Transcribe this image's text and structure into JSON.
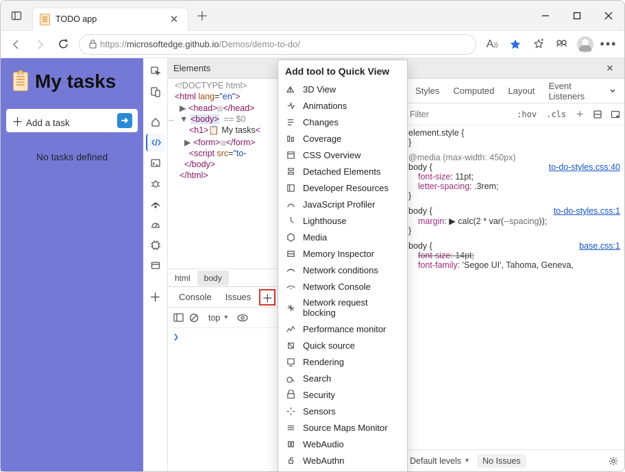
{
  "browser": {
    "tab_title": "TODO app",
    "url_https": "https://",
    "url_host": "microsoftedge.github.io",
    "url_path": "/Demos/demo-to-do/"
  },
  "page": {
    "heading": "My tasks",
    "add_placeholder": "Add a task",
    "empty_msg": "No tasks defined"
  },
  "devtools": {
    "top_tab": "Elements",
    "crumbs": {
      "html": "html",
      "body": "body"
    },
    "drawer_tabs": {
      "console": "Console",
      "issues": "Issues"
    },
    "drawer_top": "top",
    "styles_tabs": {
      "styles": "Styles",
      "computed": "Computed",
      "layout": "Layout",
      "events": "Event Listeners"
    },
    "filter_ph": "Filter",
    "hov": ":hov",
    "cls": ".cls",
    "issues_levels": "Default levels",
    "no_issues": "No Issues",
    "dom": {
      "doctype": "<!DOCTYPE html>",
      "html_open": "<html lang=\"en\">",
      "head": "<head>…</head>",
      "body_open": "<body>",
      "body_meta": "== $0",
      "h1": "<h1>📋 My tasks<",
      "form": "<form>…</form>",
      "script": "<script src=\"to-",
      "body_close": "</body>",
      "html_close": "</html>"
    },
    "rules": {
      "r0": "element.style {",
      "media": "@media (max-width: 450px)",
      "r1_sel": "body {",
      "r1_src": "to-do-styles.css:40",
      "r1_p1k": "font-size",
      "r1_p1v": "11pt;",
      "r1_p2k": "letter-spacing",
      "r1_p2v": ".3rem;",
      "r2_sel": "body {",
      "r2_src": "to-do-styles.css:1",
      "r2_p1k": "margin",
      "r2_p1v": "calc(2 * var(--spacing));",
      "r3_sel": "body {",
      "r3_src": "base.css:1",
      "r3_p1k": "font-size",
      "r3_p1v": "14pt;",
      "r3_p2k": "font-family",
      "r3_p2v": "'Segoe UI', Tahoma, Geneva,"
    }
  },
  "popup": {
    "title": "Add tool to Quick View",
    "items": [
      "3D View",
      "Animations",
      "Changes",
      "Coverage",
      "CSS Overview",
      "Detached Elements",
      "Developer Resources",
      "JavaScript Profiler",
      "Lighthouse",
      "Media",
      "Memory Inspector",
      "Network conditions",
      "Network Console",
      "Network request blocking",
      "Performance monitor",
      "Quick source",
      "Rendering",
      "Search",
      "Security",
      "Sensors",
      "Source Maps Monitor",
      "WebAudio",
      "WebAuthn"
    ]
  }
}
